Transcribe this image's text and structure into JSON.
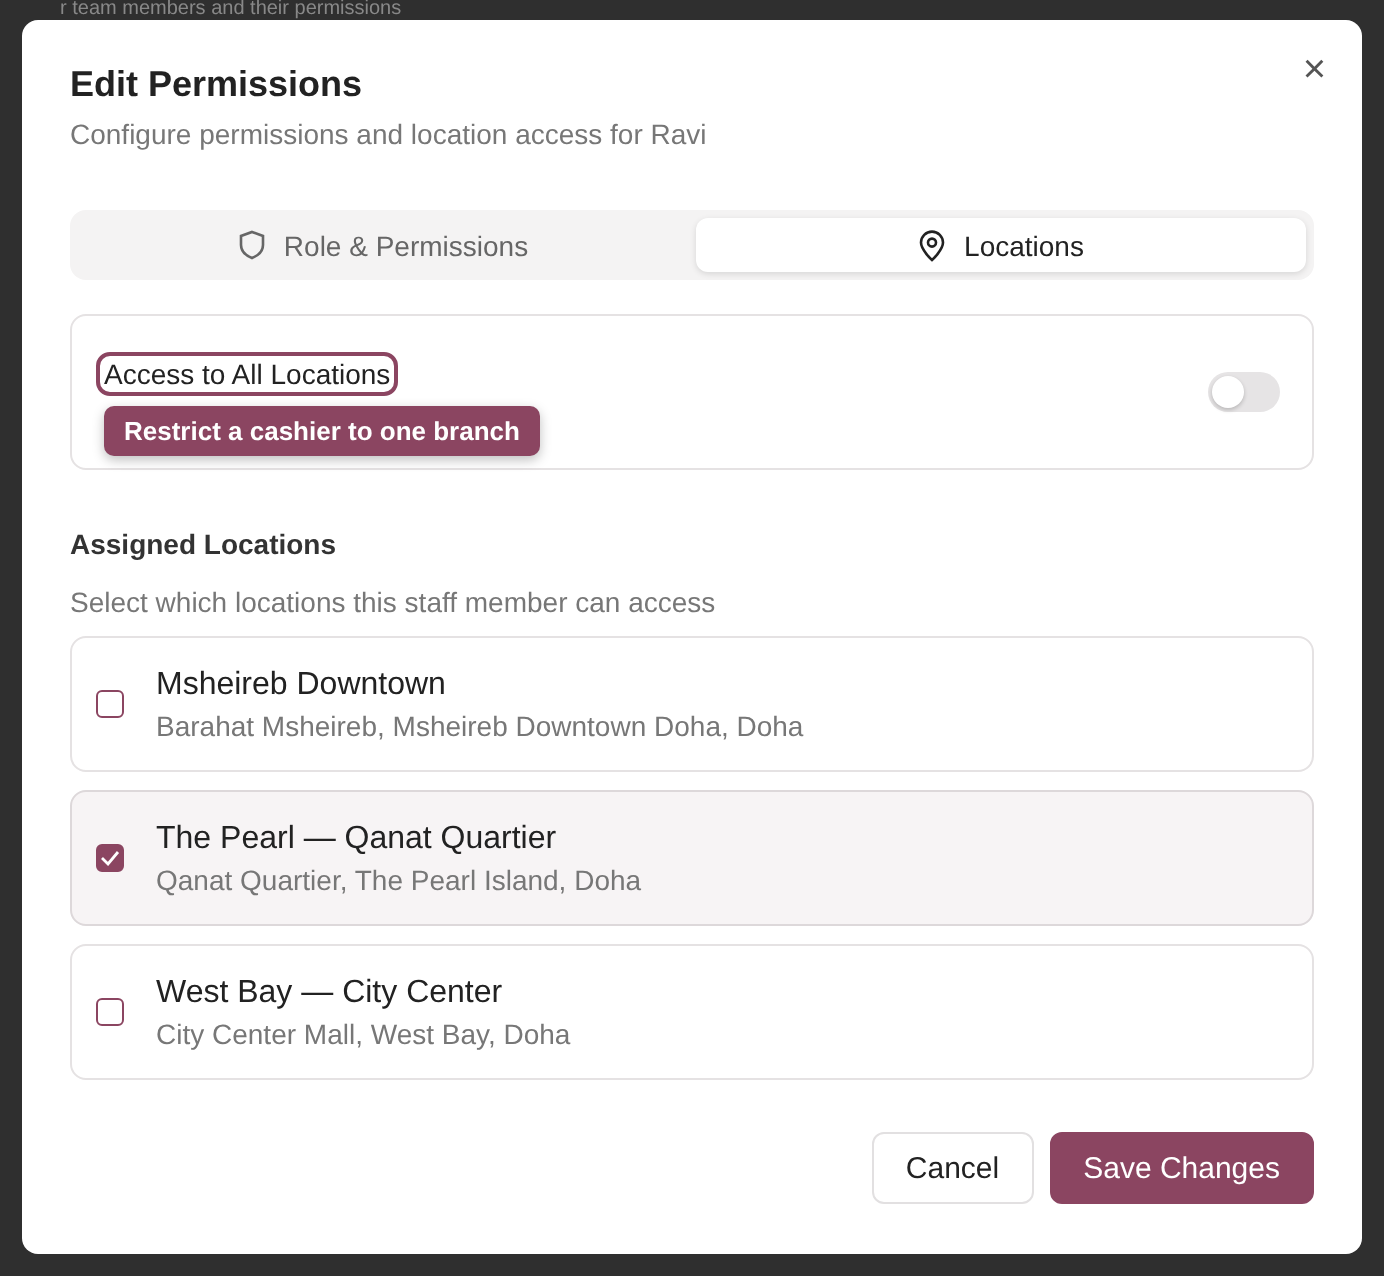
{
  "background_text": "r team members and their permissions",
  "dialog": {
    "title": "Edit Permissions",
    "subtitle": "Configure permissions and location access for Ravi",
    "close": "×"
  },
  "tabs": [
    {
      "label": "Role & Permissions",
      "selected": false
    },
    {
      "label": "Locations",
      "selected": true
    }
  ],
  "all_locations": {
    "label": "Access to All Locations",
    "on": false,
    "highlighted": true,
    "tooltip": "Restrict a cashier to one branch"
  },
  "assigned": {
    "heading": "Assigned Locations",
    "hint": "Select which locations this staff member can access"
  },
  "locations": [
    {
      "name": "Msheireb Downtown",
      "address": "Barahat Msheireb, Msheireb Downtown Doha, Doha",
      "checked": false
    },
    {
      "name": "The Pearl — Qanat Quartier",
      "address": "Qanat Quartier, The Pearl Island, Doha",
      "checked": true
    },
    {
      "name": "West Bay — City Center",
      "address": "City Center Mall, West Bay, Doha",
      "checked": false
    }
  ],
  "buttons": [
    {
      "label": "Cancel",
      "kind": "secondary"
    },
    {
      "label": "Save Changes",
      "kind": "primary"
    }
  ]
}
